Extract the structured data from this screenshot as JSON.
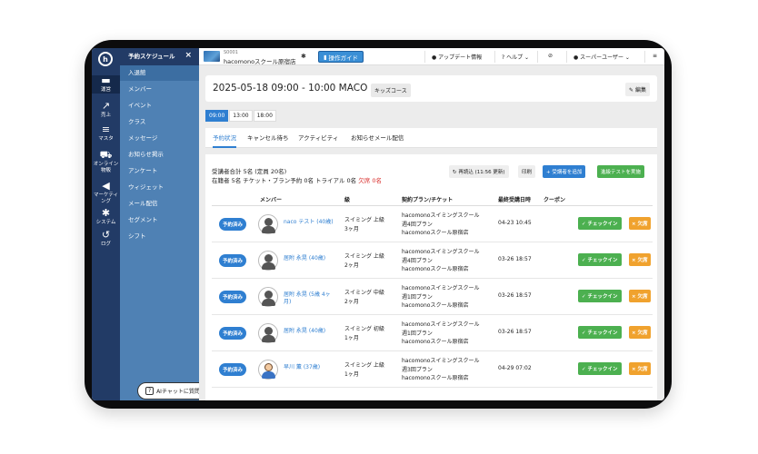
{
  "rail": {
    "items": [
      {
        "icon": "store-icon",
        "glyph": "▬",
        "label": "運営"
      },
      {
        "icon": "chart-icon",
        "glyph": "↗",
        "label": "売上"
      },
      {
        "icon": "database-icon",
        "glyph": "≡",
        "label": "マスタ"
      },
      {
        "icon": "cart-icon",
        "glyph": "⛟",
        "label": "オンライン物販"
      },
      {
        "icon": "megaphone-icon",
        "glyph": "◀",
        "label": "マーケティング"
      },
      {
        "icon": "gear-icon",
        "glyph": "✱",
        "label": "システム"
      },
      {
        "icon": "history-icon",
        "glyph": "↺",
        "label": "ログ"
      }
    ]
  },
  "submenu": {
    "close": "×",
    "items": [
      {
        "label": "予約スケジュール",
        "type": "header"
      },
      {
        "label": "入退館",
        "type": "active"
      },
      {
        "label": "メンバー",
        "type": "item"
      },
      {
        "label": "イベント",
        "type": "item"
      },
      {
        "label": "クラス",
        "type": "item"
      },
      {
        "label": "メッセージ",
        "type": "item"
      },
      {
        "label": "お知らせ掲示",
        "type": "item"
      },
      {
        "label": "アンケート",
        "type": "item"
      },
      {
        "label": "ウィジェット",
        "type": "item"
      },
      {
        "label": "メール配信",
        "type": "item"
      },
      {
        "label": "セグメント",
        "type": "item"
      },
      {
        "label": "シフト",
        "type": "item"
      }
    ],
    "ai_button": "AIチャットに質問"
  },
  "topbar": {
    "store_code": "S0001",
    "store_name": "hacomonoスクール原宿店",
    "guide": "操作ガイド",
    "update": "アップデート情報",
    "help": "ヘルプ",
    "user": "スーパーユーザー"
  },
  "lesson": {
    "title": "2025-05-18 09:00 - 10:00   MACO",
    "course": "キッズコース",
    "edit": "編集"
  },
  "times": [
    "09:00",
    "13:00",
    "18:00"
  ],
  "tabs": [
    "予約状況",
    "キャンセル待ち",
    "アクティビティ",
    "お知らせメール配信"
  ],
  "summary": {
    "line1": "受講者合計 5名 (定員 20名)",
    "line2": "在籍者 5名   チケット・プラン予約 0名   トライアル 0名",
    "absent": "欠席 0名",
    "reload": "再読込 (11:56 更新)",
    "print": "印刷",
    "add": "+ 受講者を追加",
    "test": "進級テストを実施"
  },
  "table": {
    "headers": [
      "メンバー",
      "級",
      "契約プラン/チケット",
      "最終受講日時",
      "クーポン"
    ],
    "rows": [
      {
        "status": "予約済み",
        "name": "naco テスト (40歳)",
        "level1": "スイミング 上級",
        "level2": "3ヶ月",
        "plan": [
          "hacomonoスイミングスクール",
          "週4回プラン",
          "hacomonoスクール原宿店"
        ],
        "last": "04-23 10:45",
        "avatar": "adult"
      },
      {
        "status": "予約済み",
        "name": "居附 永晃 (40歳)",
        "level1": "スイミング 上級",
        "level2": "2ヶ月",
        "plan": [
          "hacomonoスイミングスクール",
          "週4回プラン",
          "hacomonoスクール原宿店"
        ],
        "last": "03-26 18:57",
        "avatar": "adult"
      },
      {
        "status": "予約済み",
        "name": "居附 永晃 (5歳 4ヶ月)",
        "level1": "スイミング 中級",
        "level2": "2ヶ月",
        "plan": [
          "hacomonoスイミングスクール",
          "週1回プラン",
          "hacomonoスクール原宿店"
        ],
        "last": "03-26 18:57",
        "avatar": "adult"
      },
      {
        "status": "予約済み",
        "name": "居附 永晃 (40歳)",
        "level1": "スイミング 初級",
        "level2": "1ヶ月",
        "plan": [
          "hacomonoスイミングスクール",
          "週1回プラン",
          "hacomonoスクール原宿店"
        ],
        "last": "03-26 18:57",
        "avatar": "adult"
      },
      {
        "status": "予約済み",
        "name": "早川 薫 (37歳)",
        "level1": "スイミング 上級",
        "level2": "1ヶ月",
        "plan": [
          "hacomonoスイミングスクール",
          "週3回プラン",
          "hacomonoスクール原宿店"
        ],
        "last": "04-29 07:02",
        "avatar": "kid"
      }
    ],
    "checkin": "✓ チェックイン",
    "absent": "× 欠席"
  }
}
